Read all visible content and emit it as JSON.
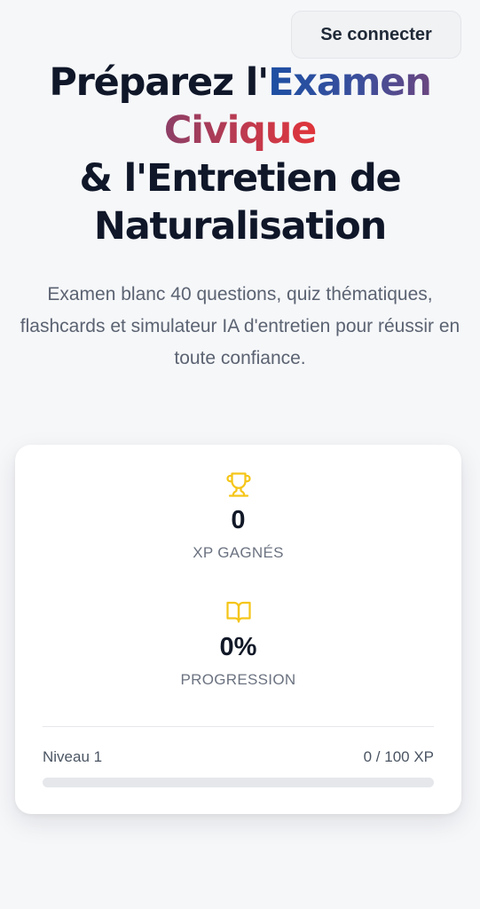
{
  "header": {
    "login_label": "Se connecter"
  },
  "hero": {
    "title_part1": "Préparez l'",
    "title_examen": "Examen",
    "title_civique": "Civique",
    "title_line3": "& l'Entretien de",
    "title_line4": "Naturalisation",
    "subtitle": "Examen blanc 40 questions, quiz thématiques, flashcards et simulateur IA d'entretien pour réussir en toute confiance."
  },
  "stats": {
    "xp": {
      "icon": "trophy-icon",
      "value": "0",
      "label": "XP GAGNÉS"
    },
    "progression": {
      "icon": "open-book-icon",
      "value": "0%",
      "label": "PROGRESSION"
    },
    "level": {
      "label": "Niveau 1",
      "xp_text": "0 / 100 XP",
      "progress_fraction": 0
    }
  },
  "colors": {
    "accent_yellow": "#f5c518",
    "gradient_blue": "#1d4fa3",
    "gradient_red": "#e0353b",
    "text_dark": "#0f1729",
    "text_muted": "#5b6372"
  }
}
